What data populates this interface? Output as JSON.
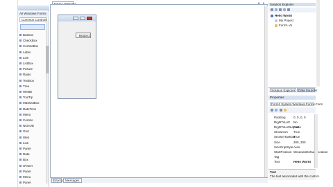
{
  "toolbox": {
    "title": "",
    "group_header": "All Windows Forms",
    "selected_group": "Common Controls",
    "items": [
      "",
      "",
      "",
      "",
      "",
      "",
      "",
      "",
      "",
      "",
      "",
      "",
      "",
      "",
      "",
      "",
      "",
      "",
      "",
      ""
    ],
    "visible_labels": [
      "Buttons",
      "CheckBox",
      "ComboBox",
      "Label",
      "Link",
      "ListBox",
      "Picture",
      "Radio",
      "TextBox",
      "Tree",
      "WebBr",
      "ToolTip",
      "MaskedBox",
      "DateTime",
      "Menu",
      "Combo",
      "NumUD",
      "Grid",
      "Web",
      "Link",
      "Panel",
      "Data",
      "Box",
      "sPanel",
      "Panel",
      "Menu",
      "Panel"
    ]
  },
  "editor": {
    "tab_label": "Form1 [Design]",
    "form_title": "",
    "button_label": "Button1",
    "controls": [
      "▾",
      "x"
    ]
  },
  "bottom_tabs": [
    "Error List",
    "Messages"
  ],
  "solution_explorer": {
    "title": "Solution Explorer",
    "items": [
      "Hello World",
      "My Project",
      "Form1.vb"
    ]
  },
  "tabs_bottom": [
    "Solution Explorer",
    "Data Sources"
  ],
  "properties": {
    "title": "Properties",
    "object": "Form1 System.Windows.Forms.Form",
    "rows": [
      {
        "name": "Padding",
        "value": "0, 0, 0, 0"
      },
      {
        "name": "RightToLeft",
        "value": "No"
      },
      {
        "name": "RightToLeftLayout",
        "value": "False"
      },
      {
        "name": "ShowIcon",
        "value": "True"
      },
      {
        "name": "ShowInTaskbar",
        "value": "True"
      },
      {
        "name": "Size",
        "value": "300, 300"
      },
      {
        "name": "SizeGripStyle",
        "value": "Auto"
      },
      {
        "name": "StartPosition",
        "value": "WindowsDefaultLocation"
      },
      {
        "name": "Tag",
        "value": ""
      },
      {
        "name": "Text",
        "value": "Hello World"
      }
    ],
    "desc_title": "Text",
    "desc_body": "The text associated with the control."
  }
}
